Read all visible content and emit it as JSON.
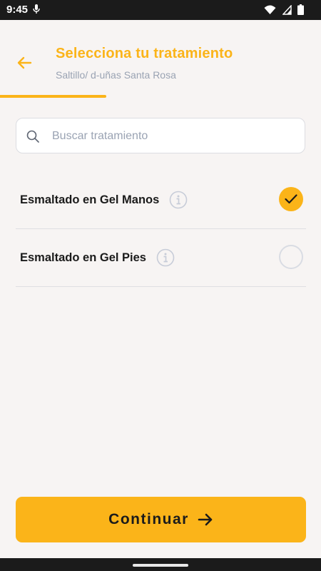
{
  "status_bar": {
    "time": "9:45"
  },
  "header": {
    "title": "Selecciona tu tratamiento",
    "subtitle": "Saltillo/ d-uñas Santa Rosa",
    "progress_fraction": 0.33
  },
  "search": {
    "placeholder": "Buscar tratamiento",
    "value": ""
  },
  "treatments": [
    {
      "label": "Esmaltado en Gel Manos",
      "selected": true
    },
    {
      "label": "Esmaltado en Gel Pies",
      "selected": false
    }
  ],
  "continue_button": {
    "label": "Continuar"
  },
  "colors": {
    "accent": "#fbb419",
    "text": "#1b1b1b",
    "muted": "#9aa3b3",
    "background": "#f7f4f3"
  }
}
